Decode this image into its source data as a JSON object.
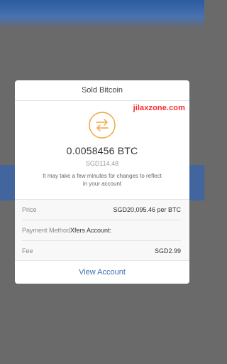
{
  "modal": {
    "title": "Sold Bitcoin",
    "watermark": "jilaxzone.com",
    "icon": "swap-arrows-icon",
    "amount": "0.0058456 BTC",
    "fiat_amount": "SGD114.48",
    "note": "It may take a few minutes for changes to reflect in your account",
    "details": [
      {
        "label": "Price",
        "value": "SGD20,095.46 per BTC"
      },
      {
        "label": "Payment Method",
        "value": "Xfers Account:"
      },
      {
        "label": "Fee",
        "value": "SGD2.99"
      }
    ],
    "action_label": "View Account"
  },
  "colors": {
    "accent_orange": "#f2a33a",
    "link_blue": "#3a6fb5",
    "overlay": "#6a6a6a"
  }
}
